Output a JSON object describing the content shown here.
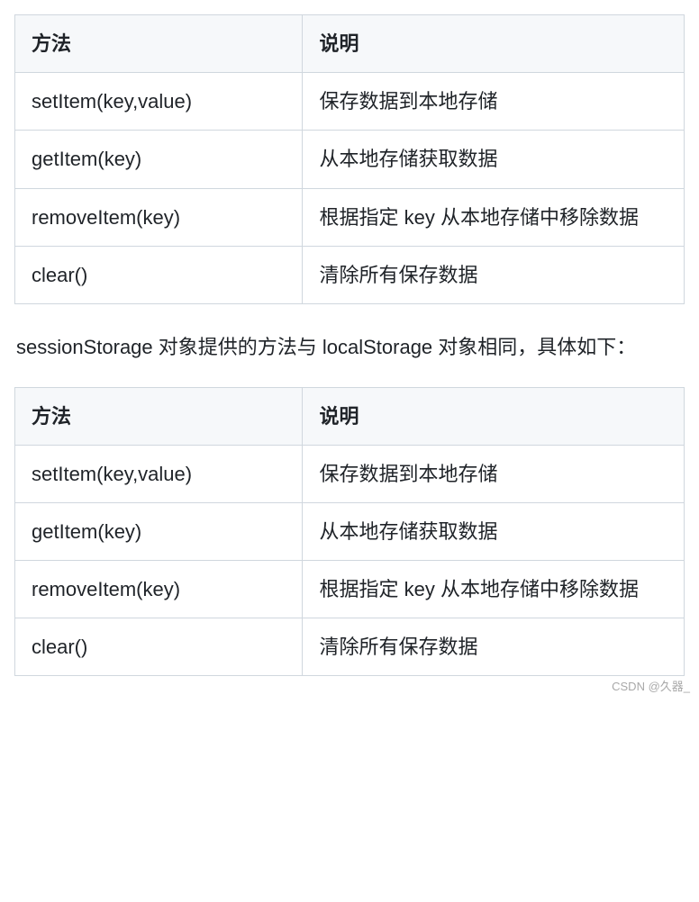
{
  "table1": {
    "headers": [
      "方法",
      "说明"
    ],
    "rows": [
      {
        "method": "setItem(key,value)",
        "desc": "保存数据到本地存储"
      },
      {
        "method": "getItem(key)",
        "desc": "从本地存储获取数据"
      },
      {
        "method": "removeItem(key)",
        "desc": "根据指定 key 从本地存储中移除数据"
      },
      {
        "method": "clear()",
        "desc": "清除所有保存数据"
      }
    ]
  },
  "paragraph": "sessionStorage 对象提供的方法与 localStorage 对象相同，具体如下：",
  "table2": {
    "headers": [
      "方法",
      "说明"
    ],
    "rows": [
      {
        "method": "setItem(key,value)",
        "desc": "保存数据到本地存储"
      },
      {
        "method": "getItem(key)",
        "desc": "从本地存储获取数据"
      },
      {
        "method": "removeItem(key)",
        "desc": "根据指定 key 从本地存储中移除数据"
      },
      {
        "method": "clear()",
        "desc": "清除所有保存数据"
      }
    ]
  },
  "watermark": "CSDN @久器_"
}
